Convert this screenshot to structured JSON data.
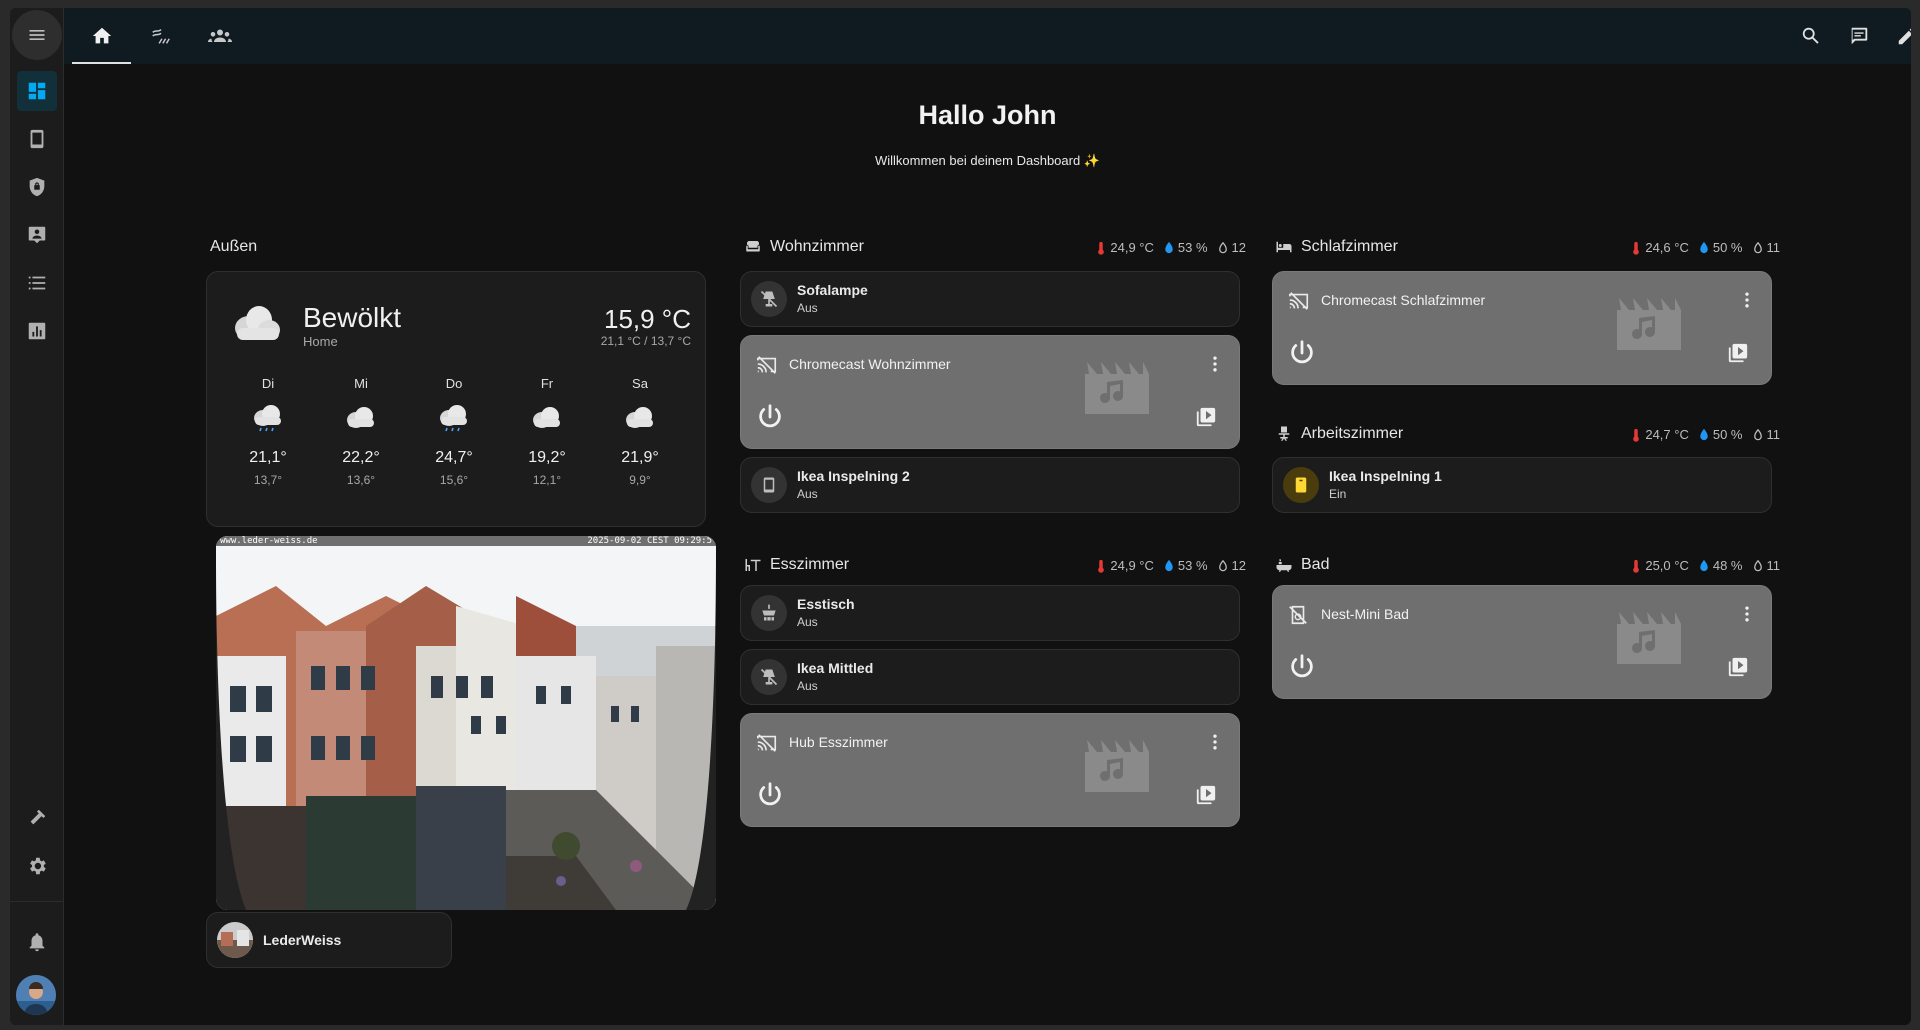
{
  "header": {
    "title": "Hallo John",
    "subtitle": "Willkommen bei deinem Dashboard ✨"
  },
  "sidebar": {
    "items": [
      "dashboard-icon",
      "tablet-icon",
      "shield-icon",
      "contact-icon",
      "list-icon",
      "chart-icon"
    ],
    "bottom": [
      "hammer-icon",
      "gear-icon",
      "bell-icon"
    ]
  },
  "topbar": {
    "tabs": [
      "home-icon",
      "weather-icon",
      "people-icon"
    ],
    "actions": [
      "search-icon",
      "message-icon",
      "pencil-icon"
    ]
  },
  "outdoor": {
    "title": "Außen",
    "weather": {
      "condition": "Bewölkt",
      "location": "Home",
      "temp": "15,9 °C",
      "range": "21,1 °C / 13,7 °C",
      "forecast": [
        {
          "day": "Di",
          "high": "21,1°",
          "low": "13,7°",
          "icon": "rain-cloud"
        },
        {
          "day": "Mi",
          "high": "22,2°",
          "low": "13,6°",
          "icon": "cloud"
        },
        {
          "day": "Do",
          "high": "24,7°",
          "low": "15,6°",
          "icon": "rain-cloud"
        },
        {
          "day": "Fr",
          "high": "19,2°",
          "low": "12,1°",
          "icon": "cloud"
        },
        {
          "day": "Sa",
          "high": "21,9°",
          "low": "9,9°",
          "icon": "cloud"
        }
      ]
    },
    "camera": {
      "overlay_left": "www.leder-weiss.de",
      "overlay_right": "2025-09-02 CEST 09:29:5"
    },
    "person": {
      "name": "LederWeiss"
    }
  },
  "rooms": {
    "wohnzimmer": {
      "title": "Wohnzimmer",
      "temp": "24,9 °C",
      "hum": "53 %",
      "co2": "12",
      "sofalampe": {
        "name": "Sofalampe",
        "state": "Aus"
      },
      "media": "Chromecast Wohnzimmer",
      "tablet": {
        "name": "Ikea Inspelning 2",
        "state": "Aus"
      }
    },
    "esszimmer": {
      "title": "Esszimmer",
      "temp": "24,9 °C",
      "hum": "53 %",
      "co2": "12",
      "esstisch": {
        "name": "Esstisch",
        "state": "Aus"
      },
      "mittled": {
        "name": "Ikea Mittled",
        "state": "Aus"
      },
      "media": "Hub Esszimmer"
    },
    "schlafzimmer": {
      "title": "Schlafzimmer",
      "temp": "24,6 °C",
      "hum": "50 %",
      "co2": "11",
      "media": "Chromecast Schlafzimmer"
    },
    "arbeitszimmer": {
      "title": "Arbeitszimmer",
      "temp": "24,7 °C",
      "hum": "50 %",
      "co2": "11",
      "plug": {
        "name": "Ikea Inspelning 1",
        "state": "Ein"
      }
    },
    "bad": {
      "title": "Bad",
      "temp": "25,0 °C",
      "hum": "48 %",
      "co2": "11",
      "media": "Nest-Mini Bad"
    }
  },
  "colors": {
    "accent": "#03a9f4",
    "temp": "#e53935",
    "hum": "#2196f3",
    "on": "#fdd835"
  }
}
